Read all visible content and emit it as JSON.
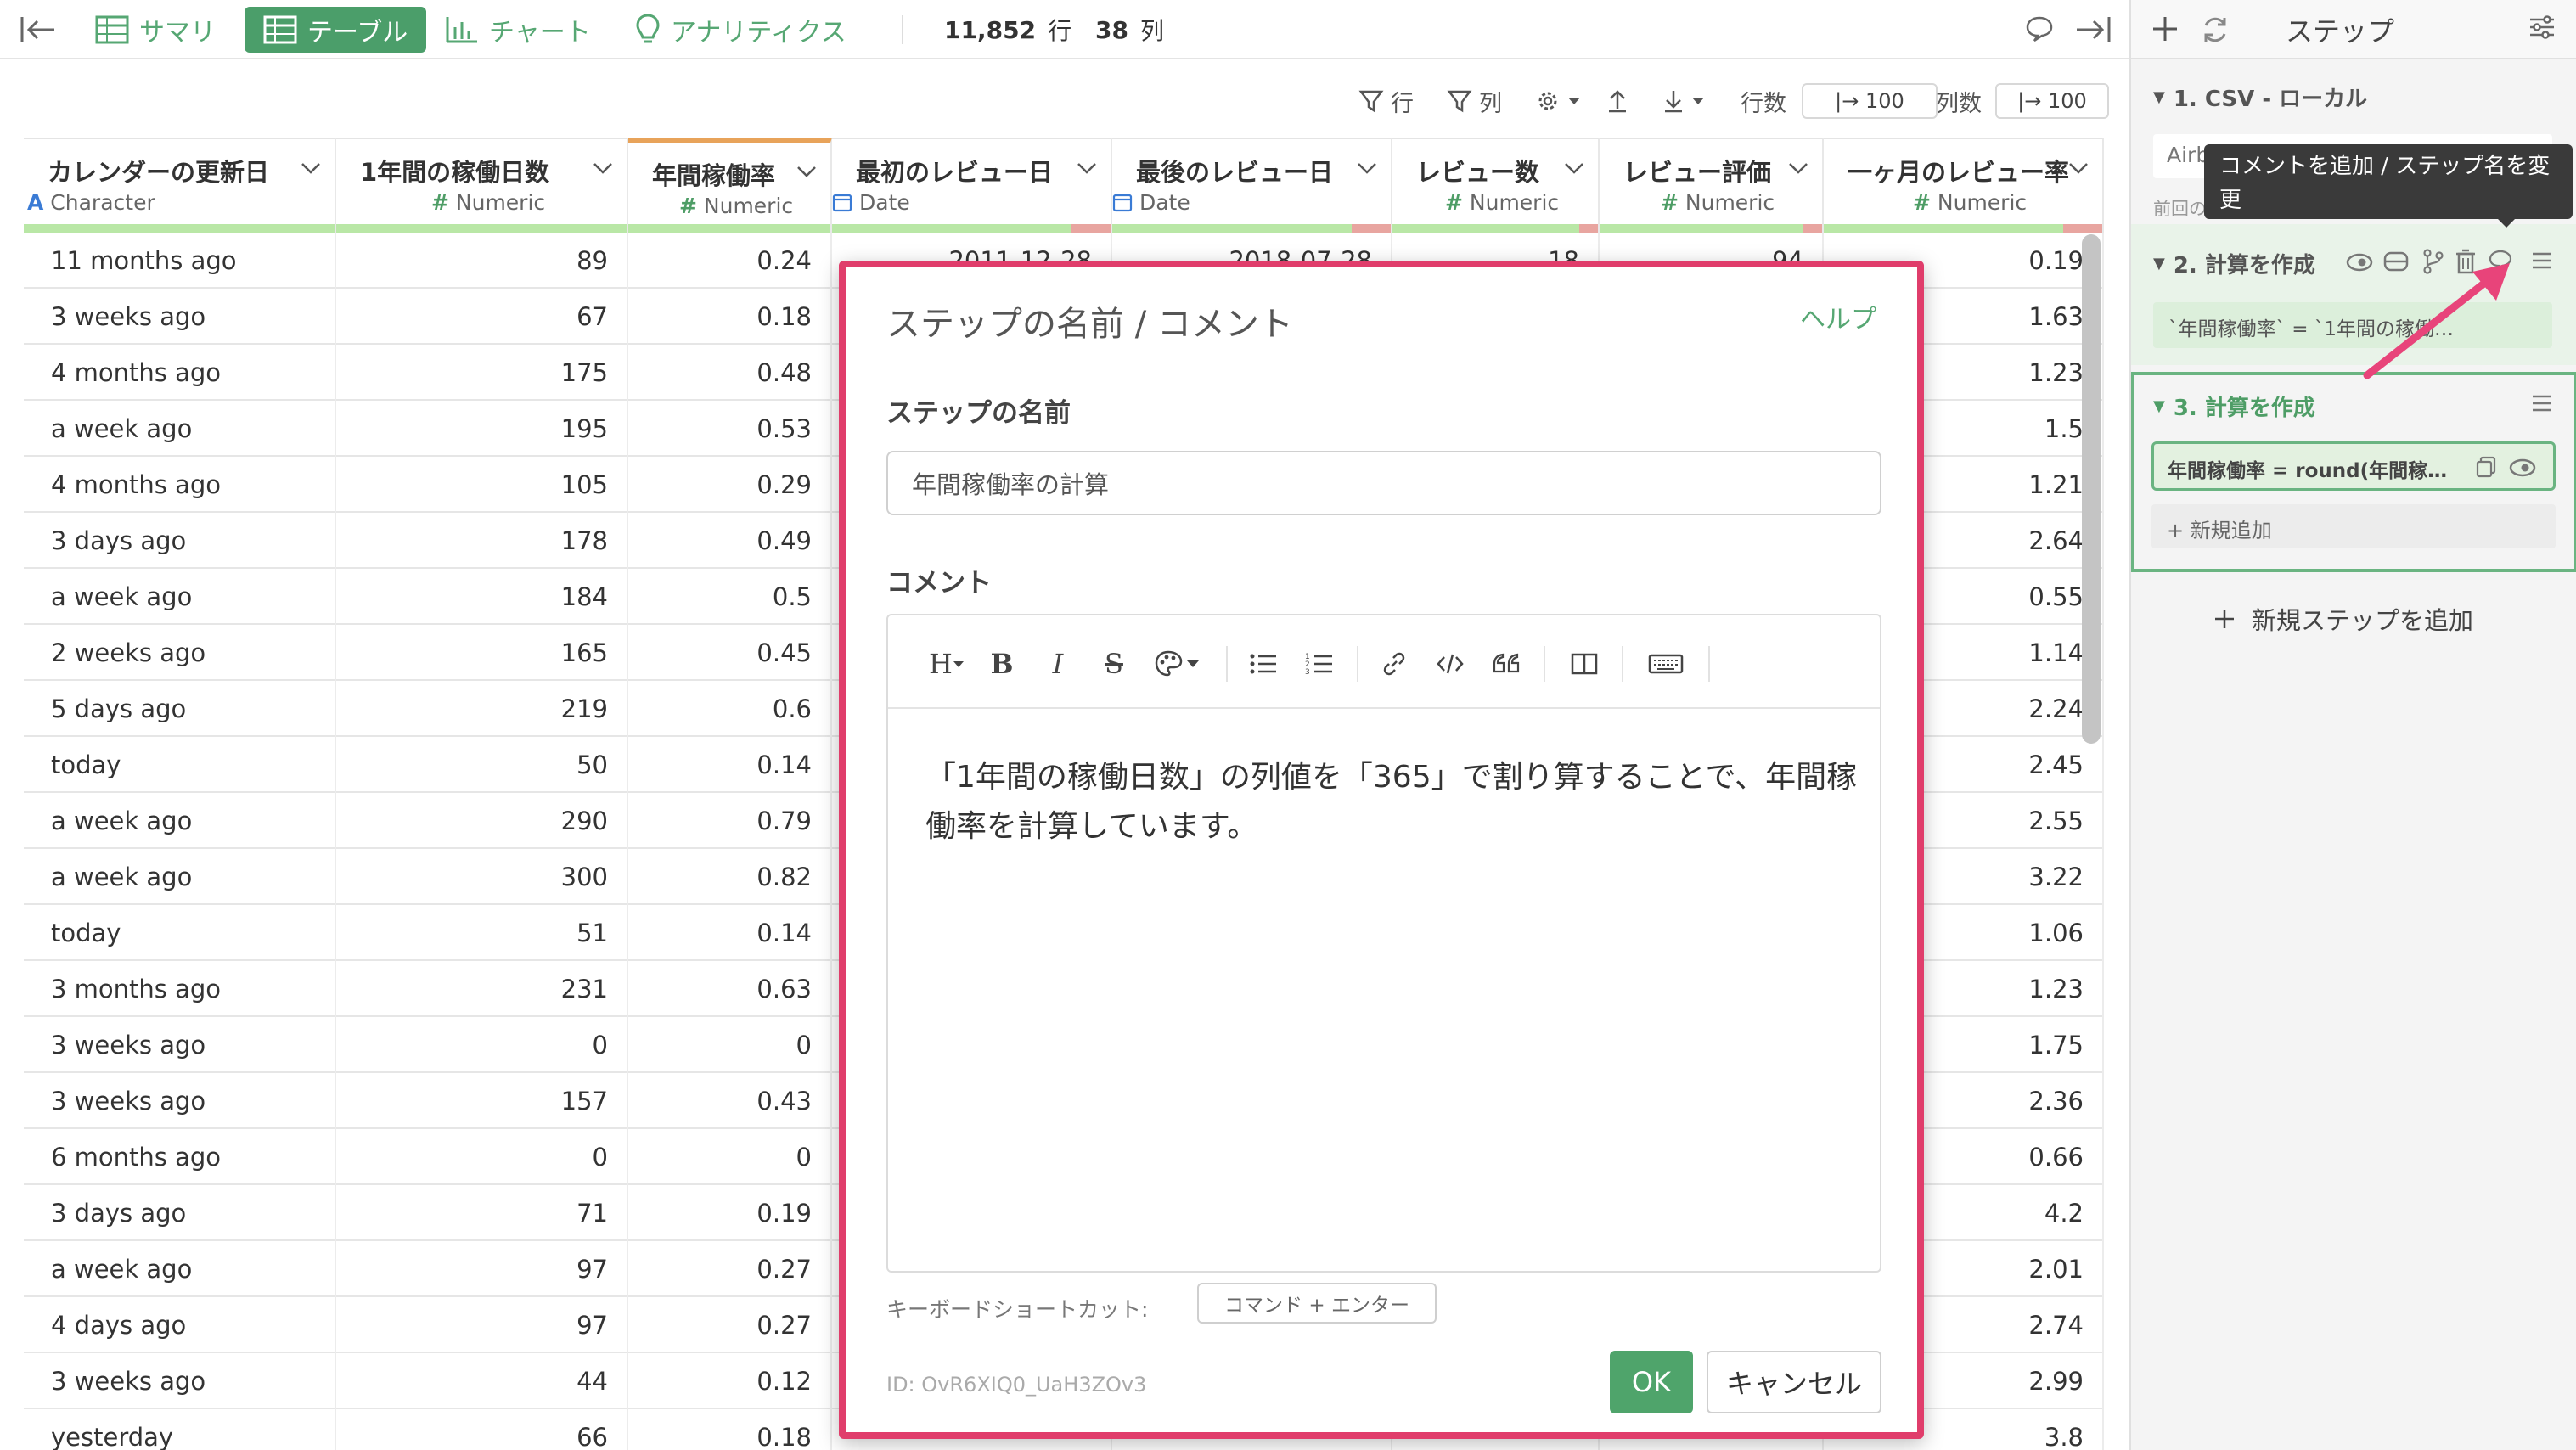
{
  "toolbar": {
    "tabs": [
      {
        "label": "サマリ",
        "icon": "table-grid-icon"
      },
      {
        "label": "テーブル",
        "icon": "table-grid-icon",
        "active": true
      },
      {
        "label": "チャート",
        "icon": "bar-chart-icon"
      },
      {
        "label": "アナリティクス",
        "icon": "lightbulb-icon"
      }
    ],
    "row_count": "11,852",
    "row_unit": "行",
    "col_count": "38",
    "col_unit": "列"
  },
  "table_toolbar": {
    "row_filter": "行",
    "col_filter": "列",
    "rows_label": "行数",
    "rows_value": "|→ 100",
    "cols_label": "列数",
    "cols_value": "|→ 100"
  },
  "columns": [
    {
      "name": "カレンダーの更新日",
      "type": "Character",
      "type_icon": "A"
    },
    {
      "name": "1年間の稼働日数",
      "type": "Numeric",
      "type_icon": "#"
    },
    {
      "name": "年間稼働率",
      "type": "Numeric",
      "type_icon": "#"
    },
    {
      "name": "最初のレビュー日",
      "type": "Date",
      "type_icon": "calendar"
    },
    {
      "name": "最後のレビュー日",
      "type": "Date",
      "type_icon": "calendar"
    },
    {
      "name": "レビュー数",
      "type": "Numeric",
      "type_icon": "#"
    },
    {
      "name": "レビュー評価",
      "type": "Numeric",
      "type_icon": "#"
    },
    {
      "name": "一ヶ月のレビュー率",
      "type": "Numeric",
      "type_icon": "#"
    }
  ],
  "rows": [
    [
      "11 months ago",
      "89",
      "0.24",
      "2011-12-28",
      "2018-07-28",
      "18",
      "94",
      "0.19"
    ],
    [
      "3 weeks ago",
      "67",
      "0.18",
      "",
      "",
      "",
      "",
      "1.63"
    ],
    [
      "4 months ago",
      "175",
      "0.48",
      "",
      "",
      "",
      "",
      "1.23"
    ],
    [
      "a week ago",
      "195",
      "0.53",
      "",
      "",
      "",
      "",
      "1.5"
    ],
    [
      "4 months ago",
      "105",
      "0.29",
      "",
      "",
      "",
      "",
      "1.21"
    ],
    [
      "3 days ago",
      "178",
      "0.49",
      "",
      "",
      "",
      "",
      "2.64"
    ],
    [
      "a week ago",
      "184",
      "0.5",
      "",
      "",
      "",
      "",
      "0.55"
    ],
    [
      "2 weeks ago",
      "165",
      "0.45",
      "",
      "",
      "",
      "",
      "1.14"
    ],
    [
      "5 days ago",
      "219",
      "0.6",
      "",
      "",
      "",
      "",
      "2.24"
    ],
    [
      "today",
      "50",
      "0.14",
      "",
      "",
      "",
      "",
      "2.45"
    ],
    [
      "a week ago",
      "290",
      "0.79",
      "",
      "",
      "",
      "",
      "2.55"
    ],
    [
      "a week ago",
      "300",
      "0.82",
      "",
      "",
      "",
      "",
      "3.22"
    ],
    [
      "today",
      "51",
      "0.14",
      "",
      "",
      "",
      "",
      "1.06"
    ],
    [
      "3 months ago",
      "231",
      "0.63",
      "",
      "",
      "",
      "",
      "1.23"
    ],
    [
      "3 weeks ago",
      "0",
      "0",
      "",
      "",
      "",
      "",
      "1.75"
    ],
    [
      "3 weeks ago",
      "157",
      "0.43",
      "",
      "",
      "",
      "",
      "2.36"
    ],
    [
      "6 months ago",
      "0",
      "0",
      "",
      "",
      "",
      "",
      "0.66"
    ],
    [
      "3 days ago",
      "71",
      "0.19",
      "",
      "",
      "",
      "",
      "4.2"
    ],
    [
      "a week ago",
      "97",
      "0.27",
      "",
      "",
      "",
      "",
      "2.01"
    ],
    [
      "4 days ago",
      "97",
      "0.27",
      "",
      "",
      "",
      "",
      "2.74"
    ],
    [
      "3 weeks ago",
      "44",
      "0.12",
      "",
      "",
      "",
      "",
      "2.99"
    ],
    [
      "yesterday",
      "66",
      "0.18",
      "",
      "",
      "",
      "",
      "3.8"
    ]
  ],
  "modal": {
    "title": "ステップの名前 / コメント",
    "help": "ヘルプ",
    "name_label": "ステップの名前",
    "name_value": "年間稼働率の計算",
    "comment_label": "コメント",
    "comment_text": "「1年間の稼働日数」の列値を「365」で割り算することで、年間稼働率を計算しています。",
    "shortcut_label": "キーボードショートカット:",
    "shortcut_key": "コマンド + エンター",
    "id_text": "ID: OvR6XIQ0_UaH3ZOv3",
    "ok": "OK",
    "cancel": "キャンセル"
  },
  "panel": {
    "title": "ステップ",
    "step1": "1. CSV - ローカル",
    "step1_sub": "Airb",
    "step1_sub2": "前回の",
    "step2": "2. 計算を作成",
    "step2_expr": "`年間稼働率` = `1年間の稼働…",
    "step3": "3. 計算を作成",
    "step3_expr": "年間稼働率 = round(年間稼…",
    "add_item": "+ 新規追加",
    "add_step": "新規ステップを追加",
    "tooltip": "コメントを追加 / ステップ名を変更"
  },
  "colors": {
    "brand_green": "#4b9e6a",
    "modal_border": "#e03d6b",
    "arrow": "#e8447a"
  }
}
